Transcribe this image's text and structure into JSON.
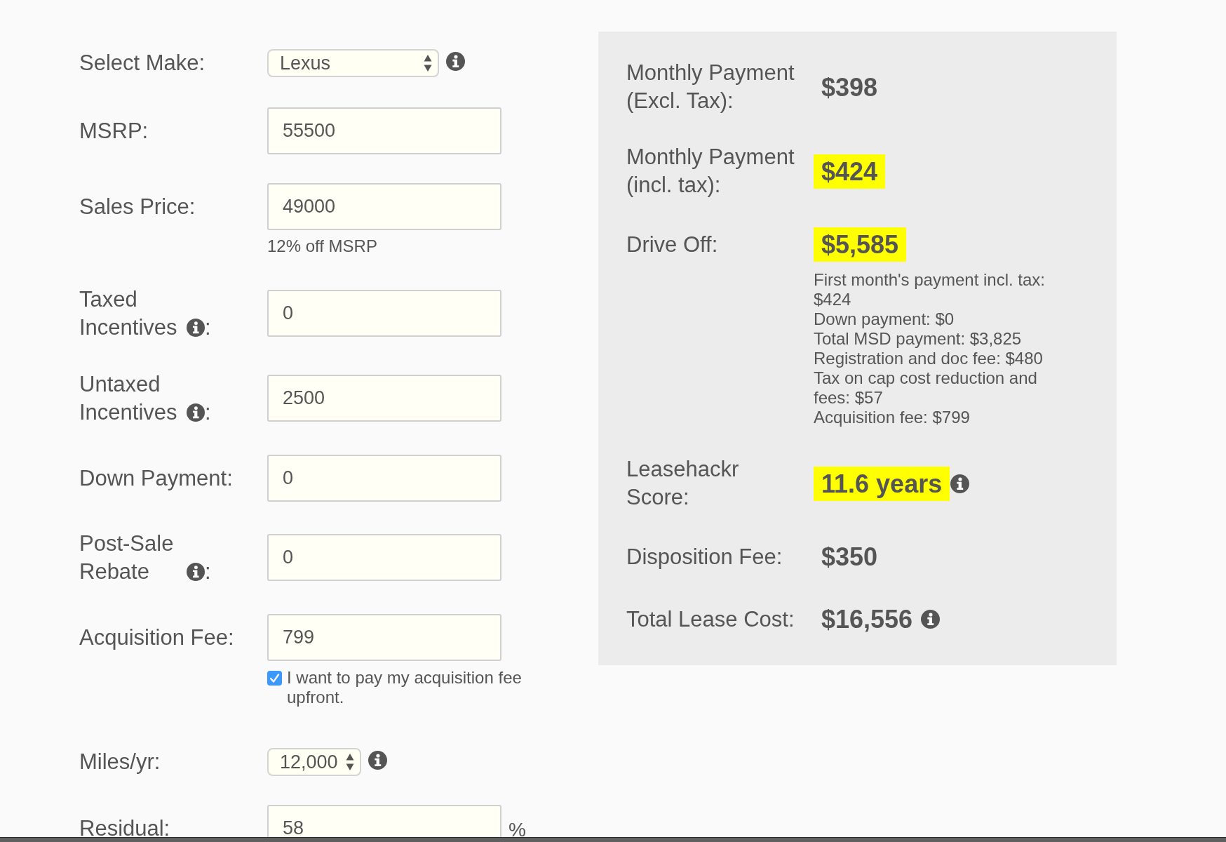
{
  "form": {
    "rows": [
      {
        "kind": "select",
        "label": "Select Make:",
        "value": "Lexus",
        "info": true
      },
      {
        "kind": "input",
        "label": "MSRP:",
        "value": "55500"
      },
      {
        "kind": "input",
        "label": "Sales Price:",
        "value": "49000",
        "hint": "12% off MSRP"
      },
      {
        "kind": "input",
        "label": "Taxed Incentives",
        "label_info": true,
        "label_end": ":",
        "value": "0"
      },
      {
        "kind": "input",
        "label": "Untaxed Incentives",
        "label_info": true,
        "label_end": ":",
        "value": "2500"
      },
      {
        "kind": "input",
        "label": "Down Payment:",
        "value": "0"
      },
      {
        "kind": "input",
        "label": "Post-Sale Rebate",
        "label_info": true,
        "label_end": ":",
        "value": "0"
      },
      {
        "kind": "input",
        "label": "Acquisition Fee:",
        "value": "799",
        "checkbox": {
          "checked": true,
          "label": "I want to pay my acquisition fee upfront."
        }
      },
      {
        "kind": "select",
        "label": "Miles/yr:",
        "value": "12,000",
        "info": true
      },
      {
        "kind": "input",
        "label": "Residual:",
        "value": "58",
        "unit": "%"
      }
    ]
  },
  "results": {
    "rows": [
      {
        "label": "Monthly Payment (Excl. Tax):",
        "value": "$398",
        "highlighted": false
      },
      {
        "label": "Monthly Payment (incl. tax):",
        "value": "$424",
        "highlighted": true
      },
      {
        "label": "Drive Off:",
        "value": "$5,585",
        "highlighted": true,
        "breakdown": [
          "First month's payment incl. tax: $424",
          "Down payment: $0",
          "Total MSD payment: $3,825",
          "Registration and doc fee: $480",
          "Tax on cap cost reduction and fees: $57",
          "Acquisition fee: $799"
        ]
      },
      {
        "label": "Leasehackr Score:",
        "value": "11.6 years",
        "highlighted": true,
        "info": true
      },
      {
        "label": "Disposition Fee:",
        "value": "$350",
        "highlighted": false
      },
      {
        "label": "Total Lease Cost:",
        "value": "$16,556",
        "highlighted": false,
        "info": true
      }
    ]
  }
}
